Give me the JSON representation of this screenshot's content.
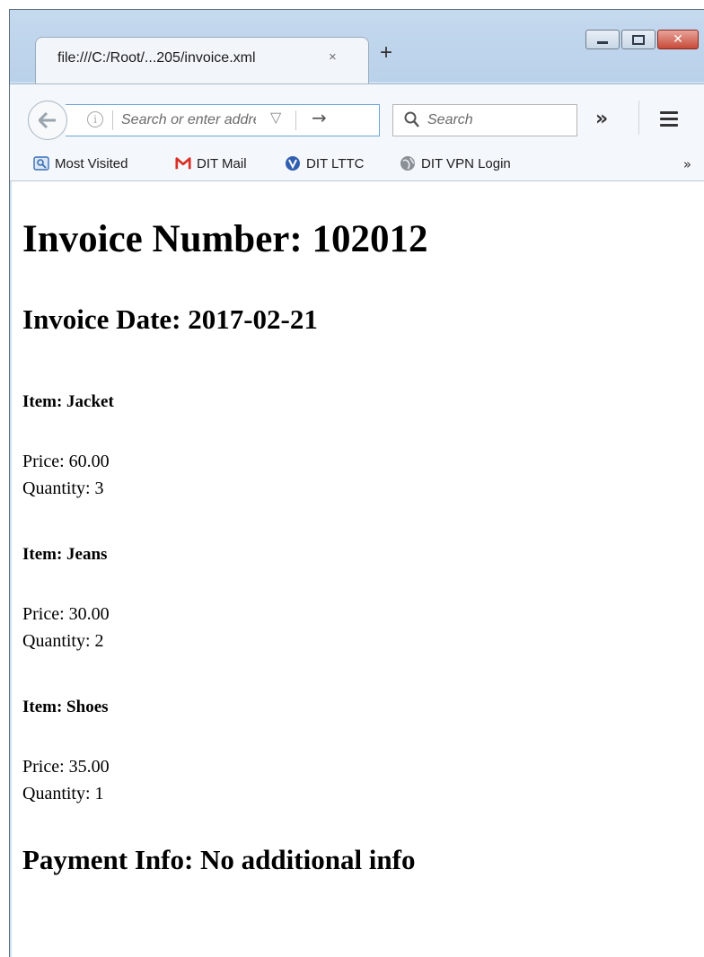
{
  "browser": {
    "tab": {
      "title": "file:///C:/Root/...205/invoice.xml",
      "close": "×"
    },
    "new_tab": "+",
    "address": {
      "placeholder": "Search or enter addre"
    },
    "search": {
      "placeholder": "Search"
    },
    "overflow": "»",
    "bookmarks": [
      {
        "label": "Most Visited",
        "icon": "most-visited-icon"
      },
      {
        "label": "DIT Mail",
        "icon": "gmail-icon"
      },
      {
        "label": "DIT LTTC",
        "icon": "lttc-icon"
      },
      {
        "label": "DIT VPN Login",
        "icon": "globe-icon"
      }
    ],
    "bookmarks_overflow": "»"
  },
  "invoice": {
    "number_heading": "Invoice Number: 102012",
    "date_heading": "Invoice Date: 2017-02-21",
    "items": [
      {
        "heading": "Item: Jacket",
        "price": "Price: 60.00",
        "quantity": "Quantity: 3"
      },
      {
        "heading": "Item: Jeans",
        "price": "Price: 30.00",
        "quantity": "Quantity: 2"
      },
      {
        "heading": "Item: Shoes",
        "price": "Price: 35.00",
        "quantity": "Quantity: 1"
      }
    ],
    "payment_heading": "Payment Info: No additional info"
  }
}
